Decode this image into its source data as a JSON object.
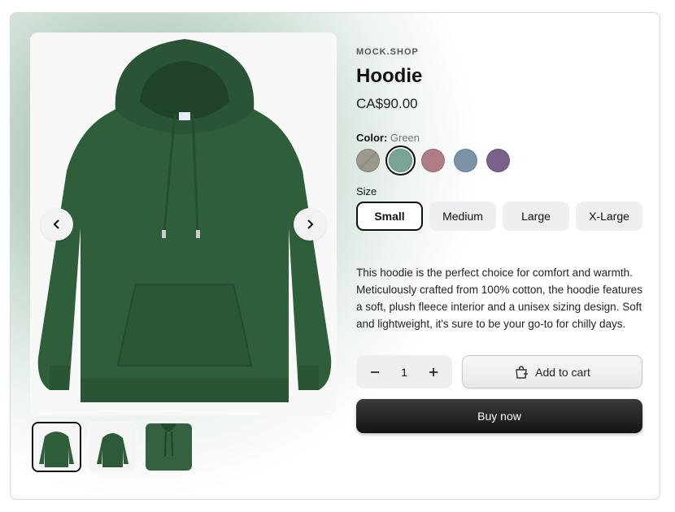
{
  "vendor": "MOCK.SHOP",
  "product": {
    "title": "Hoodie",
    "price": "CA$90.00",
    "description": "This hoodie is the perfect choice for comfort and warmth. Meticulously crafted from 100% cotton, the hoodie features a soft, plush fleece interior and a unisex sizing design. Soft and lightweight, it's sure to be your go-to for chilly days."
  },
  "color": {
    "label": "Color:",
    "selected": "Green",
    "swatches": [
      {
        "name": "Taupe",
        "hex": "#9a978c"
      },
      {
        "name": "Green",
        "hex": "#7aa595"
      },
      {
        "name": "Rose",
        "hex": "#b07c86"
      },
      {
        "name": "Blue",
        "hex": "#7a93a8"
      },
      {
        "name": "Purple",
        "hex": "#79618a"
      }
    ]
  },
  "size": {
    "label": "Size",
    "options": [
      "Small",
      "Medium",
      "Large",
      "X-Large"
    ],
    "selected": "Small"
  },
  "quantity": "1",
  "buttons": {
    "add_to_cart": "Add to cart",
    "buy_now": "Buy now"
  },
  "icons": {
    "prev": "chevron-left-icon",
    "next": "chevron-right-icon",
    "minus": "minus-icon",
    "plus": "plus-icon",
    "cart": "shopping-bag-plus-icon"
  },
  "colors": {
    "hoodie": "#2f5e3b",
    "accent": "#111111"
  }
}
